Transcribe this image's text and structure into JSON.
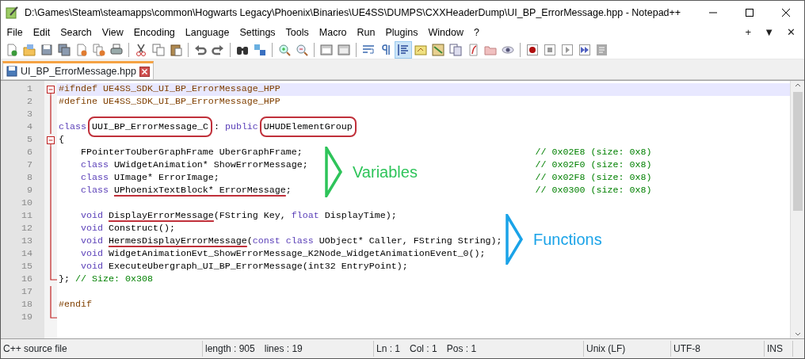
{
  "window": {
    "title": "D:\\Games\\Steam\\steamapps\\common\\Hogwarts Legacy\\Phoenix\\Binaries\\UE4SS\\DUMPS\\CXXHeaderDump\\UI_BP_ErrorMessage.hpp - Notepad++"
  },
  "menu": [
    "File",
    "Edit",
    "Search",
    "View",
    "Encoding",
    "Language",
    "Settings",
    "Tools",
    "Macro",
    "Run",
    "Plugins",
    "Window",
    "?"
  ],
  "menu_right": [
    "+",
    "▼",
    "✕"
  ],
  "toolbar": [
    [
      {
        "kind": "new",
        "selected": false
      },
      {
        "kind": "open",
        "selected": false
      },
      {
        "kind": "save",
        "selected": false
      },
      {
        "kind": "saveall",
        "selected": false
      },
      {
        "kind": "close",
        "selected": false
      },
      {
        "kind": "closeall",
        "selected": false
      },
      {
        "kind": "print",
        "selected": false
      }
    ],
    [
      {
        "kind": "cut",
        "selected": false
      },
      {
        "kind": "copy",
        "selected": false
      },
      {
        "kind": "paste",
        "selected": false
      }
    ],
    [
      {
        "kind": "undo",
        "selected": false
      },
      {
        "kind": "redo",
        "selected": false
      }
    ],
    [
      {
        "kind": "find",
        "selected": false
      },
      {
        "kind": "replace",
        "selected": false
      }
    ],
    [
      {
        "kind": "zoomin",
        "selected": false
      },
      {
        "kind": "zoomout",
        "selected": false
      }
    ],
    [
      {
        "kind": "syncv",
        "selected": false
      },
      {
        "kind": "synch",
        "selected": false
      }
    ],
    [
      {
        "kind": "wrap",
        "selected": false
      },
      {
        "kind": "para",
        "selected": false
      },
      {
        "kind": "indent",
        "selected": true
      },
      {
        "kind": "lang",
        "selected": false
      },
      {
        "kind": "map",
        "selected": false
      },
      {
        "kind": "doclist",
        "selected": false
      },
      {
        "kind": "funclist",
        "selected": false
      },
      {
        "kind": "folder",
        "selected": false
      },
      {
        "kind": "eye",
        "selected": false
      }
    ],
    [
      {
        "kind": "record",
        "selected": false
      },
      {
        "kind": "stop",
        "selected": false
      },
      {
        "kind": "play",
        "selected": false
      },
      {
        "kind": "playmulti",
        "selected": false
      },
      {
        "kind": "savemacro",
        "selected": false
      }
    ]
  ],
  "tabs": [
    {
      "label": "UI_BP_ErrorMessage.hpp",
      "selected": true
    }
  ],
  "editor": {
    "lines": [
      {
        "number": "1",
        "current": true,
        "kind": "fold-start",
        "indent": false,
        "segments": [
          {
            "kind": "preproc",
            "text": "#ifndef UE4SS_SDK_UI_BP_ErrorMessage_HPP"
          }
        ]
      },
      {
        "number": "2",
        "current": false,
        "kind": "body",
        "indent": false,
        "segments": [
          {
            "kind": "preproc",
            "text": "#define UE4SS_SDK_UI_BP_ErrorMessage_HPP"
          }
        ]
      },
      {
        "number": "3",
        "current": false,
        "kind": "body"
      },
      {
        "number": "4",
        "current": false,
        "kind": "body",
        "indent": false,
        "segments": [
          {
            "kind": "keyword",
            "text": "class "
          },
          {
            "kind": "circled",
            "text": "UUI_BP_ErrorMessage_C"
          },
          {
            "kind": "plain",
            "text": " : "
          },
          {
            "kind": "keyword",
            "text": "public "
          },
          {
            "kind": "circled",
            "text": "UHUDElementGroup"
          }
        ]
      },
      {
        "number": "5",
        "current": false,
        "kind": "fold-start",
        "indent": false,
        "segments": [
          {
            "kind": "plain",
            "text": "{"
          }
        ]
      },
      {
        "number": "6",
        "current": false,
        "kind": "body",
        "indent": true,
        "segments": [
          {
            "kind": "plain",
            "text": "FPointerToUberGraphFrame UberGraphFrame;"
          }
        ],
        "comment": "// 0x02E8 (size: 0x8)"
      },
      {
        "number": "7",
        "current": false,
        "kind": "body",
        "indent": true,
        "segments": [
          {
            "kind": "keyword",
            "text": "class"
          },
          {
            "kind": "plain",
            "text": " UWidgetAnimation* ShowErrorMessage;"
          }
        ],
        "comment": "// 0x02F0 (size: 0x8)"
      },
      {
        "number": "8",
        "current": false,
        "kind": "body",
        "indent": true,
        "segments": [
          {
            "kind": "keyword",
            "text": "class"
          },
          {
            "kind": "plain",
            "text": " UImage* ErrorImage;"
          }
        ],
        "comment": "// 0x02F8 (size: 0x8)"
      },
      {
        "number": "9",
        "current": false,
        "kind": "body",
        "indent": true,
        "segments": [
          {
            "kind": "keyword",
            "text": "class "
          },
          {
            "kind": "underlined",
            "text": "UPhoenixTextBlock* ErrorMessage"
          },
          {
            "kind": "plain",
            "text": ";"
          }
        ],
        "comment": "// 0x0300 (size: 0x8)"
      },
      {
        "number": "10",
        "current": false,
        "kind": "body"
      },
      {
        "number": "11",
        "current": false,
        "kind": "body",
        "indent": true,
        "segments": [
          {
            "kind": "keyword",
            "text": "void "
          },
          {
            "kind": "underlined",
            "text": "DisplayErrorMessage"
          },
          {
            "kind": "plain",
            "text": "(FString Key, "
          },
          {
            "kind": "keyword",
            "text": "float"
          },
          {
            "kind": "plain",
            "text": " DisplayTime);"
          }
        ]
      },
      {
        "number": "12",
        "current": false,
        "kind": "body",
        "indent": true,
        "segments": [
          {
            "kind": "keyword",
            "text": "void"
          },
          {
            "kind": "plain",
            "text": " Construct();"
          }
        ]
      },
      {
        "number": "13",
        "current": false,
        "kind": "body",
        "indent": true,
        "segments": [
          {
            "kind": "keyword",
            "text": "void "
          },
          {
            "kind": "underlined",
            "text": "HermesDisplayErrorMessage"
          },
          {
            "kind": "plain",
            "text": "("
          },
          {
            "kind": "keyword",
            "text": "const class"
          },
          {
            "kind": "plain",
            "text": " UObject* Caller, FString String);"
          }
        ]
      },
      {
        "number": "14",
        "current": false,
        "kind": "body",
        "indent": true,
        "segments": [
          {
            "kind": "keyword",
            "text": "void"
          },
          {
            "kind": "plain",
            "text": " WidgetAnimationEvt_ShowErrorMessage_K2Node_WidgetAnimationEvent_0();"
          }
        ]
      },
      {
        "number": "15",
        "current": false,
        "kind": "body",
        "indent": true,
        "segments": [
          {
            "kind": "keyword",
            "text": "void"
          },
          {
            "kind": "plain",
            "text": " ExecuteUbergraph_UI_BP_ErrorMessage(int32 EntryPoint);"
          }
        ]
      },
      {
        "number": "16",
        "current": false,
        "kind": "fold-end",
        "indent": false,
        "segments": [
          {
            "kind": "plain",
            "text": "};"
          },
          {
            "kind": "comment",
            "text": " // Size: 0x308"
          }
        ]
      },
      {
        "number": "17",
        "current": false,
        "kind": "body"
      },
      {
        "number": "18",
        "current": false,
        "kind": "body",
        "indent": false,
        "segments": [
          {
            "kind": "preproc",
            "text": "#endif"
          }
        ]
      },
      {
        "number": "19",
        "current": false,
        "kind": "fold-end"
      }
    ]
  },
  "annotations": [
    {
      "label": "Variables",
      "color": "#2ec45a"
    },
    {
      "label": "Functions",
      "color": "#1aa3e8"
    }
  ],
  "status_bar": [
    [
      "C++ source file"
    ],
    [
      "length : 905",
      "lines : 19"
    ],
    [
      "Ln : 1",
      "Col : 1",
      "Pos : 1"
    ],
    [
      "Unix (LF)"
    ],
    [
      "UTF-8"
    ],
    [
      "INS"
    ]
  ]
}
